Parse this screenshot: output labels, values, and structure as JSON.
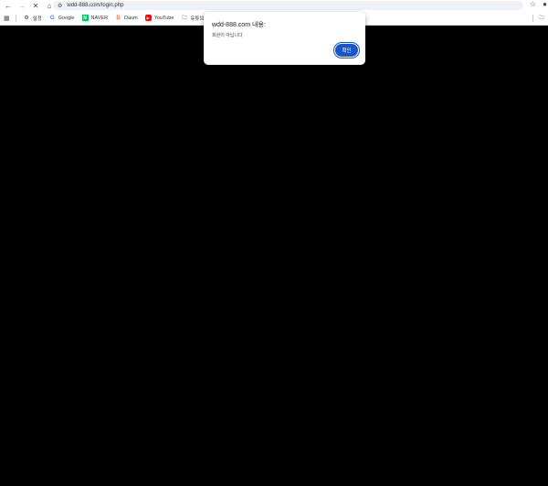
{
  "browser": {
    "url": "wdd-888.com/login.php",
    "bookmarks": [
      {
        "label": "설정",
        "icon": "gear-icon"
      },
      {
        "label": "Google",
        "icon": "google-icon"
      },
      {
        "label": "NAVER",
        "icon": "naver-icon"
      },
      {
        "label": "Daum",
        "icon": "daum-icon"
      },
      {
        "label": "YouTube",
        "icon": "youtube-icon"
      },
      {
        "label": "유튜브",
        "icon": "folder-icon"
      }
    ]
  },
  "dialog": {
    "title": "wdd-888.com 내용:",
    "message": "회원이 아닙니다",
    "ok_label": "확인"
  },
  "colors": {
    "accent": "#1a56c7",
    "page_background": "#000000"
  }
}
